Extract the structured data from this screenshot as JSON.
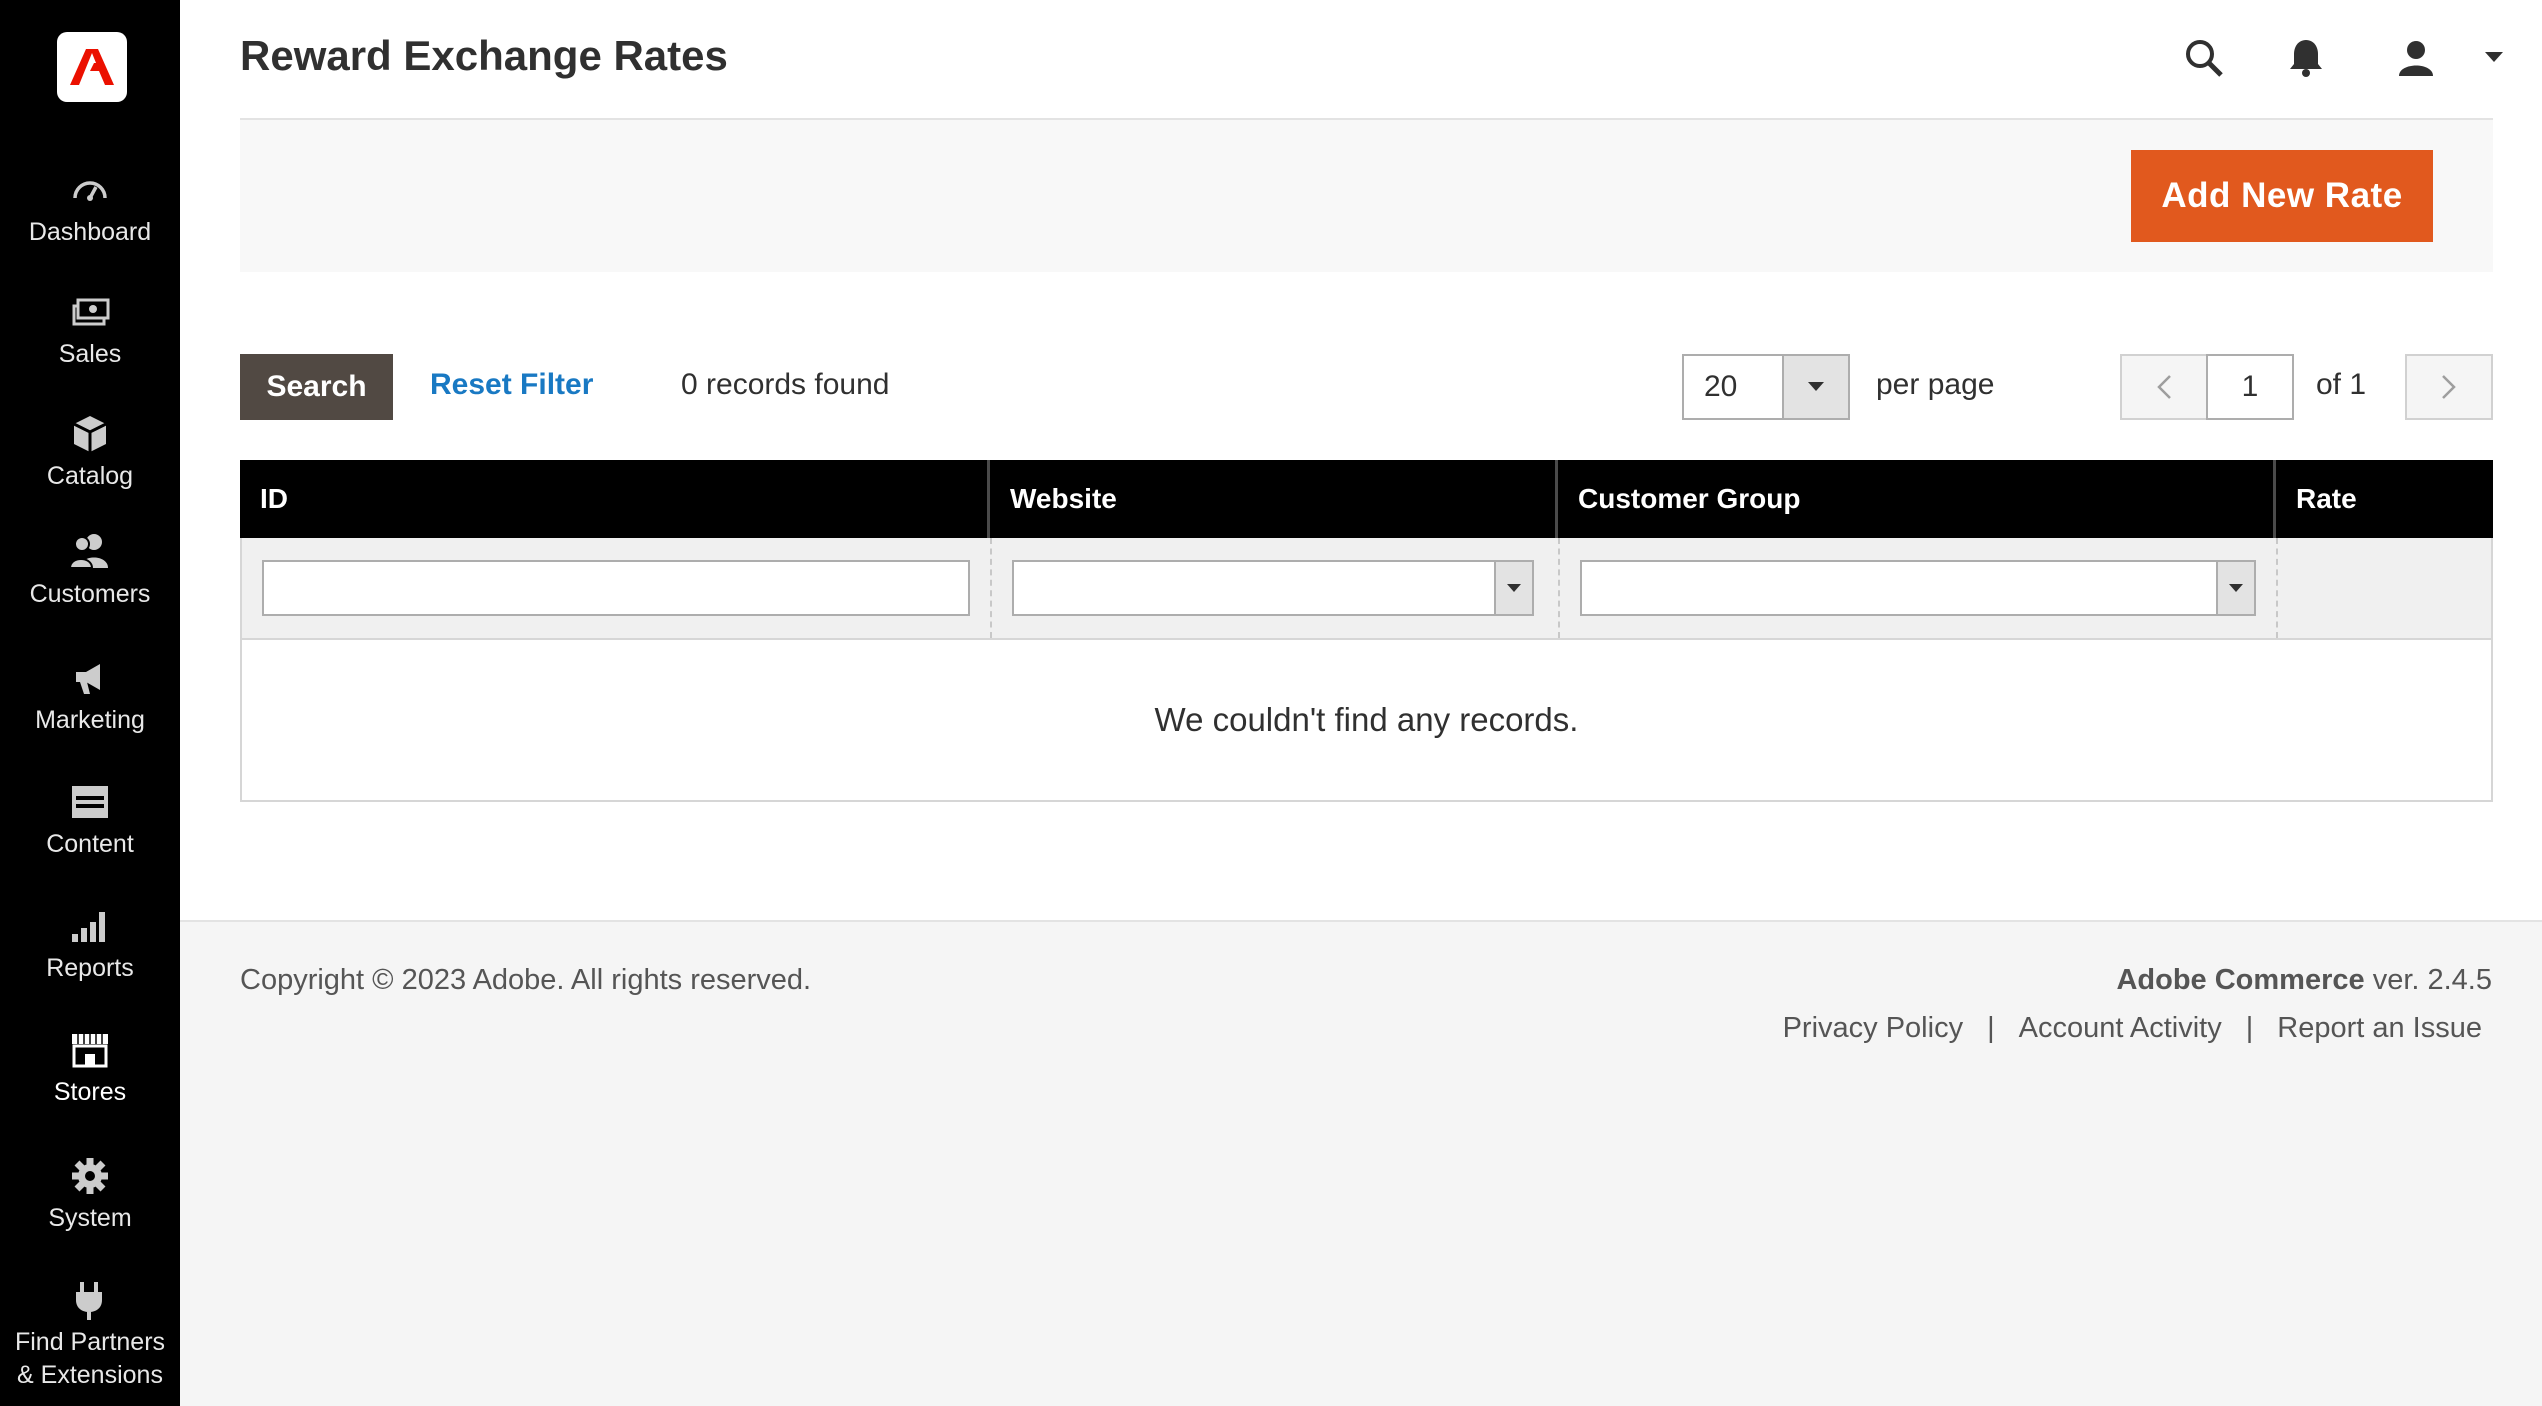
{
  "sidebar": {
    "items": [
      {
        "label": "Dashboard",
        "icon": "dashboard-icon"
      },
      {
        "label": "Sales",
        "icon": "sales-icon"
      },
      {
        "label": "Catalog",
        "icon": "catalog-icon"
      },
      {
        "label": "Customers",
        "icon": "customers-icon"
      },
      {
        "label": "Marketing",
        "icon": "marketing-icon"
      },
      {
        "label": "Content",
        "icon": "content-icon"
      },
      {
        "label": "Reports",
        "icon": "reports-icon"
      },
      {
        "label": "Stores",
        "icon": "stores-icon"
      },
      {
        "label": "System",
        "icon": "system-icon"
      },
      {
        "label": "Find Partners\n& Extensions",
        "icon": "partners-icon"
      }
    ]
  },
  "header": {
    "title": "Reward Exchange Rates"
  },
  "actions": {
    "add_label": "Add New Rate"
  },
  "toolbar": {
    "search_label": "Search",
    "reset_label": "Reset Filter",
    "records_text": "0 records found",
    "per_page_value": "20",
    "per_page_label": "per page",
    "page_value": "1",
    "page_of": "of 1"
  },
  "grid": {
    "columns": [
      "ID",
      "Website",
      "Customer Group",
      "Rate"
    ],
    "empty_text": "We couldn't find any records."
  },
  "footer": {
    "copyright": "Copyright © 2023 Adobe. All rights reserved.",
    "product": "Adobe Commerce",
    "version": " ver. 2.4.5",
    "links": [
      "Privacy Policy",
      "Account Activity",
      "Report an Issue"
    ],
    "separator": "|"
  },
  "colors": {
    "sidebar": "#000000",
    "accent": "#e1591e",
    "link": "#1979c3",
    "search_button": "#514943"
  }
}
